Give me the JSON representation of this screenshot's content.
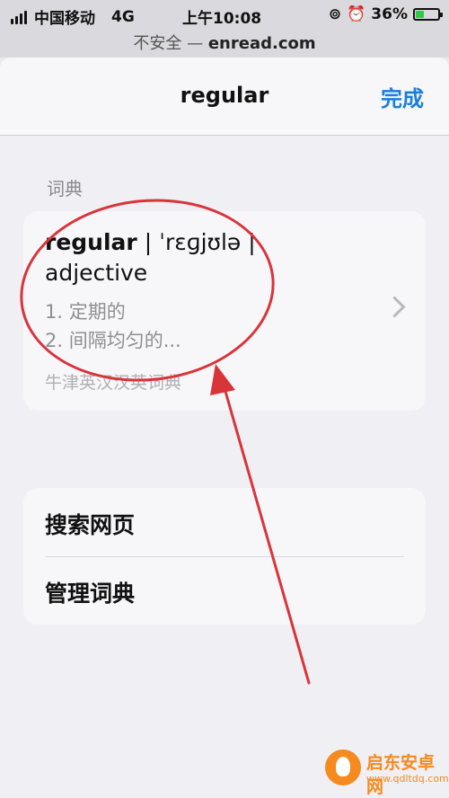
{
  "status_bar": {
    "carrier": "中国移动",
    "network": "4G",
    "time": "上午10:08",
    "battery": "36%",
    "battery_level": 0.36
  },
  "url_bar": {
    "security": "不安全 —",
    "domain": "enread.com"
  },
  "sheet": {
    "title": "regular",
    "done": "完成"
  },
  "dictionary": {
    "section": "词典",
    "word": "regular",
    "phonetic": " | ˈrɛɡjʊlə | ",
    "part_of_speech": "adjective",
    "def1": "1. 定期的",
    "def2": "2. 间隔均匀的...",
    "source": "牛津英汉汉英词典"
  },
  "actions": {
    "search_web": "搜索网页",
    "manage_dictionaries": "管理词典"
  },
  "watermark": {
    "title": "启东安卓网",
    "url": "www.qdltdq.com"
  },
  "colors": {
    "accent": "#1a7fd9",
    "annotation": "#d9343a",
    "watermark": "#f58a1f"
  }
}
